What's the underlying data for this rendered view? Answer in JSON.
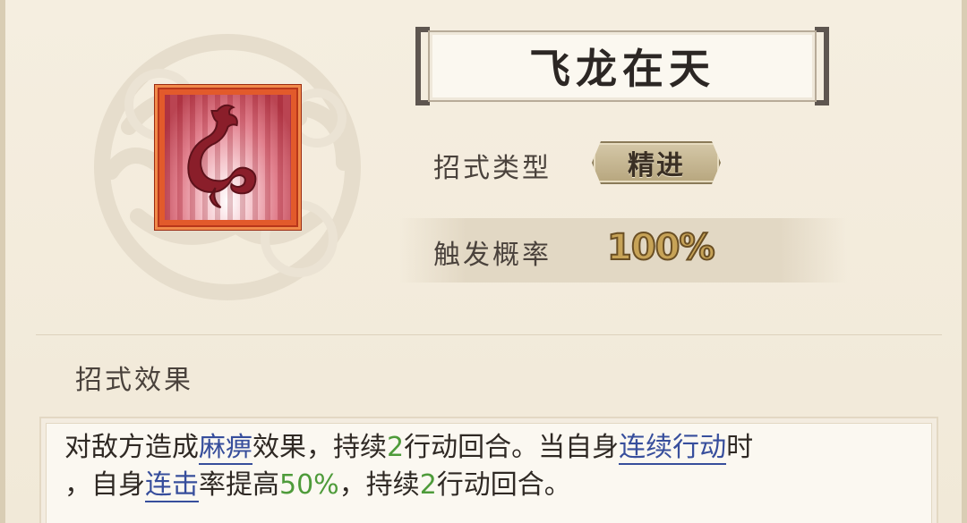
{
  "skill": {
    "name": "飞龙在天",
    "icon": "red-dragon-skill-icon"
  },
  "attributes": {
    "type_label": "招式类型",
    "type_value": "精进",
    "prob_label": "触发概率",
    "prob_value": "100%"
  },
  "effect": {
    "heading": "招式效果",
    "line1": {
      "t1": "对敌方造成",
      "kw1": "麻痹",
      "t2": "效果，持续",
      "n1": "2",
      "t3": "行动回合。当自身",
      "kw2": "连续行动",
      "t4": "时"
    },
    "line2": {
      "t1": "，自身",
      "kw1": "连击",
      "t2": "率提高",
      "n1": "50%",
      "t3": "，持续",
      "n2": "2",
      "t4": "行动回合。"
    }
  },
  "colors": {
    "keyword": "#374e9c",
    "number": "#4e9b3a",
    "prob": "#c7a357",
    "icon_frame": "#e25a2b"
  }
}
